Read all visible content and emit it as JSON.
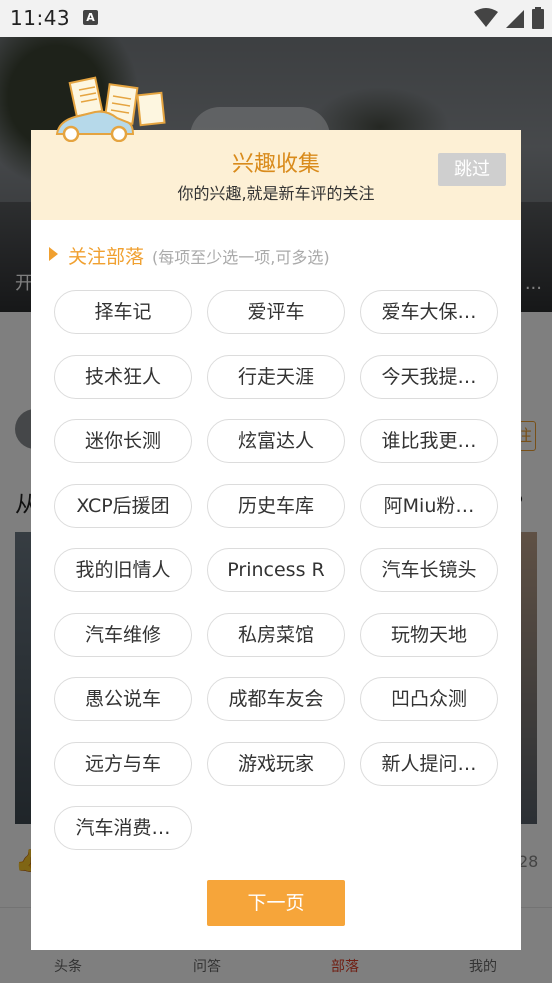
{
  "status_bar": {
    "time": "11:43",
    "a_icon": "A"
  },
  "background": {
    "hero_title": "开",
    "hero_more": "...",
    "follow_label": "注",
    "post_title_start": "从",
    "post_title_end": "？",
    "count": "28",
    "tabs": [
      {
        "label": "头条"
      },
      {
        "label": "问答"
      },
      {
        "label": "部落"
      },
      {
        "label": "我的"
      }
    ]
  },
  "dialog": {
    "title": "兴趣收集",
    "subtitle": "你的兴趣,就是新车评的关注",
    "skip_label": "跳过",
    "section_title": "关注部落",
    "section_hint": "(每项至少选一项,可多选)",
    "tags": [
      "择车记",
      "爱评车",
      "爱车大保…",
      "技术狂人",
      "行走天涯",
      "今天我提…",
      "迷你长测",
      "炫富达人",
      "谁比我更…",
      "XCP后援团",
      "历史车库",
      "阿Miu粉…",
      "我的旧情人",
      "Princess R",
      "汽车长镜头",
      "汽车维修",
      "私房菜馆",
      "玩物天地",
      "愚公说车",
      "成都车友会",
      "凹凸众测",
      "远方与车",
      "游戏玩家",
      "新人提问…",
      "汽车消费…"
    ],
    "next_label": "下一页"
  },
  "colors": {
    "accent": "#f0a030",
    "title": "#d98b1c",
    "header_bg": "#fdf0d5",
    "active_tab": "#e0402a"
  }
}
